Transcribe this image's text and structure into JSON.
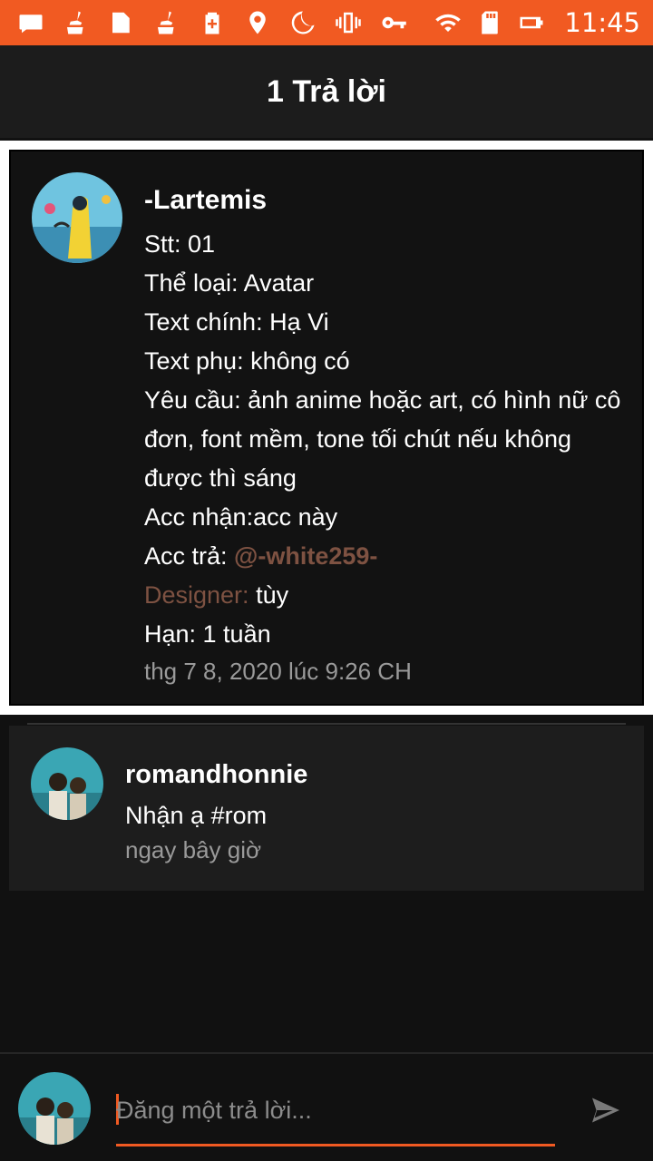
{
  "status_bar": {
    "time": "11:45",
    "icons": [
      "message-icon",
      "cleaner-icon",
      "gift-icon",
      "cleaner-icon",
      "battery-saver-icon",
      "location-icon",
      "moon-icon",
      "vibrate-icon",
      "key-icon",
      "wifi-icon",
      "sd-card-icon",
      "battery-icon"
    ]
  },
  "header": {
    "title": "1 Trả lời"
  },
  "post": {
    "username": "-Lartemis",
    "lines": [
      "Stt: 01",
      "Thể loại: Avatar",
      "Text chính: Hạ Vi",
      "Text phụ: không có",
      "Yêu cầu: ảnh anime hoặc art, có hình nữ cô đơn, font mềm, tone tối chút nếu không được thì sáng",
      "Acc nhận:acc này"
    ],
    "acc_tra_label": "Acc trả: ",
    "acc_tra_mention": "@-white259-",
    "designer_label": "Designer:",
    "designer_value": " tùy",
    "deadline": "Hạn: 1 tuần",
    "timestamp": "thg 7 8, 2020 lúc 9:26 CH"
  },
  "reply": {
    "username": "romandhonnie",
    "text": "Nhận ạ #rom",
    "time": "ngay bây giờ"
  },
  "composer": {
    "placeholder": "Đăng một trả lời..."
  },
  "colors": {
    "accent": "#f15a22",
    "mention": "#7e5242",
    "background": "#111111"
  }
}
